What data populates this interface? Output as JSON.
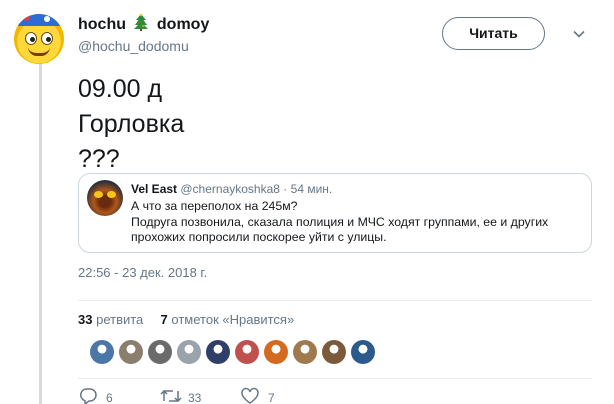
{
  "author": {
    "name_part1": "hochu",
    "name_part2": "domoy",
    "handle": "@hochu_dodomu",
    "avatar_icon": "smiley-face-avatar"
  },
  "follow_button": {
    "label": "Читать"
  },
  "tweet": {
    "lines": [
      "09.00 д",
      "Горловка",
      "???"
    ]
  },
  "quote": {
    "name": "Vel East",
    "handle": "@chernaykoshka8",
    "separator": "·",
    "time": "54 мин.",
    "line1": "А что за переполох на 245м?",
    "line2": "Подруга позвонила, сказала полиция и МЧС ходят группами, ее и других",
    "line3": "прохожих попросили поскорее уйти с улицы."
  },
  "timestamp": "22:56 - 23 дек. 2018 г.",
  "stats": {
    "retweets_count": "33",
    "retweets_label": "ретвита",
    "likes_count": "7",
    "likes_label": "отметок «Нравится»"
  },
  "likers": [
    {
      "name": "liker-avatar-1",
      "color": "#4a76a8"
    },
    {
      "name": "liker-avatar-2",
      "color": "#8a7f6e"
    },
    {
      "name": "liker-avatar-3",
      "color": "#6b6b6b"
    },
    {
      "name": "liker-avatar-4",
      "color": "#9aa2aa"
    },
    {
      "name": "liker-avatar-5",
      "color": "#2f3f6a"
    },
    {
      "name": "liker-avatar-6",
      "color": "#c0504d"
    },
    {
      "name": "liker-avatar-7",
      "color": "#d46a1f"
    },
    {
      "name": "liker-avatar-8",
      "color": "#a0794e"
    },
    {
      "name": "liker-avatar-9",
      "color": "#7a5a3a"
    },
    {
      "name": "liker-avatar-10",
      "color": "#2c5a8c"
    }
  ],
  "actions": {
    "reply_count": "6",
    "retweet_count": "33",
    "like_count": "7"
  },
  "colors": {
    "text": "#14171a",
    "secondary": "#657786",
    "border": "#ccd6dd"
  }
}
